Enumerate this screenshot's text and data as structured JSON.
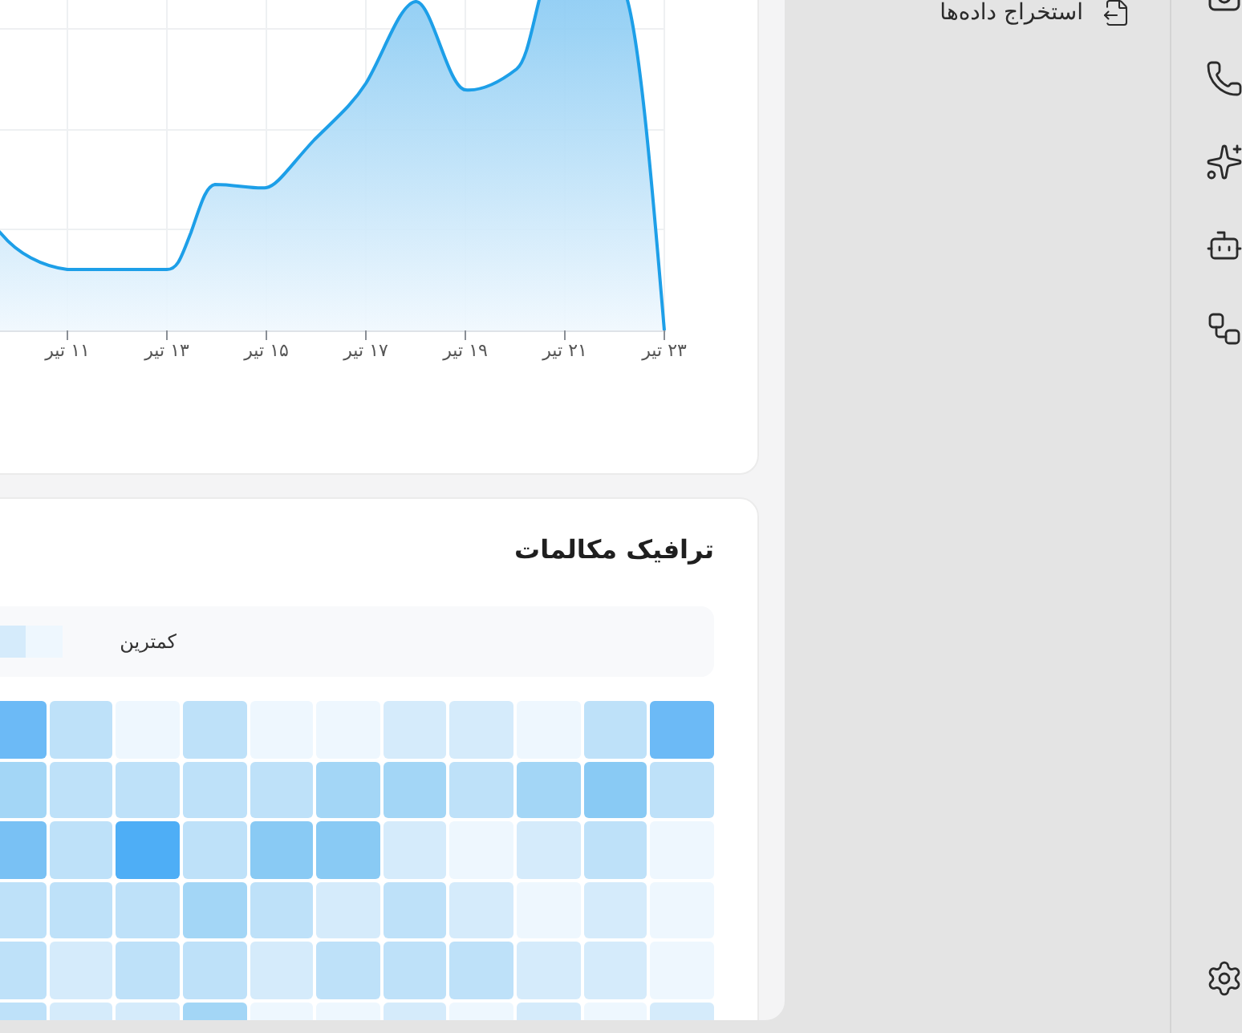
{
  "sidebar": {
    "items": [
      {
        "label": "استخراج داده‌ها"
      }
    ]
  },
  "chart": {
    "x_axis_labels": [
      "۲۳ تیر",
      "۲۱ تیر",
      "۱۹ تیر",
      "۱۷ تیر",
      "۱۵ تیر",
      "۱۳ تیر",
      "۱۱ تیر"
    ]
  },
  "call_traffic": {
    "title": "ترافیک مکالمات",
    "legend": {
      "min_label": "کمترین",
      "swatches": [
        {
          "color": "#eef7fe"
        },
        {
          "color": "#d5ebfb"
        }
      ]
    },
    "heatmap": {
      "rows": [
        {
          "cells": [
            {
              "color": "#6cbaf6"
            },
            {
              "color": "#bee1f9"
            },
            {
              "color": "#eef7fe"
            },
            {
              "color": "#d5ebfb"
            },
            {
              "color": "#d5ebfb"
            },
            {
              "color": "#eef7fe"
            },
            {
              "color": "#eef7fe"
            },
            {
              "color": "#bee1f9"
            },
            {
              "color": "#eef7fe"
            },
            {
              "color": "#bee1f9"
            },
            {
              "color": "#6cbaf6"
            }
          ]
        },
        {
          "cells": [
            {
              "color": "#bee1f9"
            },
            {
              "color": "#89caf4"
            },
            {
              "color": "#a3d6f6"
            },
            {
              "color": "#bee1f9"
            },
            {
              "color": "#a3d6f6"
            },
            {
              "color": "#a3d6f6"
            },
            {
              "color": "#bee1f9"
            },
            {
              "color": "#bee1f9"
            },
            {
              "color": "#bee1f9"
            },
            {
              "color": "#bee1f9"
            },
            {
              "color": "#a3d6f6"
            }
          ]
        },
        {
          "cells": [
            {
              "color": "#eef7fe"
            },
            {
              "color": "#bee1f9"
            },
            {
              "color": "#d5ebfb"
            },
            {
              "color": "#eef7fe"
            },
            {
              "color": "#d5ebfb"
            },
            {
              "color": "#89caf4"
            },
            {
              "color": "#89caf4"
            },
            {
              "color": "#bee1f9"
            },
            {
              "color": "#4eaef6"
            },
            {
              "color": "#bee1f9"
            },
            {
              "color": "#79c1f4"
            }
          ]
        },
        {
          "cells": [
            {
              "color": "#eef7fe"
            },
            {
              "color": "#d5ebfb"
            },
            {
              "color": "#eef7fe"
            },
            {
              "color": "#d5ebfb"
            },
            {
              "color": "#bee1f9"
            },
            {
              "color": "#d5ebfb"
            },
            {
              "color": "#bee1f9"
            },
            {
              "color": "#a3d6f6"
            },
            {
              "color": "#bee1f9"
            },
            {
              "color": "#bee1f9"
            },
            {
              "color": "#bee1f9"
            }
          ]
        },
        {
          "cells": [
            {
              "color": "#eef7fe"
            },
            {
              "color": "#d5ebfb"
            },
            {
              "color": "#d5ebfb"
            },
            {
              "color": "#bee1f9"
            },
            {
              "color": "#bee1f9"
            },
            {
              "color": "#bee1f9"
            },
            {
              "color": "#d5ebfb"
            },
            {
              "color": "#bee1f9"
            },
            {
              "color": "#bee1f9"
            },
            {
              "color": "#d5ebfb"
            },
            {
              "color": "#bee1f9"
            }
          ]
        },
        {
          "cells": [
            {
              "color": "#d5ebfb"
            },
            {
              "color": "#eef7fe"
            },
            {
              "color": "#d5ebfb"
            },
            {
              "color": "#eef7fe"
            },
            {
              "color": "#d5ebfb"
            },
            {
              "color": "#eef7fe"
            },
            {
              "color": "#eef7fe"
            },
            {
              "color": "#a3d6f6"
            },
            {
              "color": "#d5ebfb"
            },
            {
              "color": "#d5ebfb"
            },
            {
              "color": "#bee1f9"
            }
          ]
        }
      ]
    }
  }
}
